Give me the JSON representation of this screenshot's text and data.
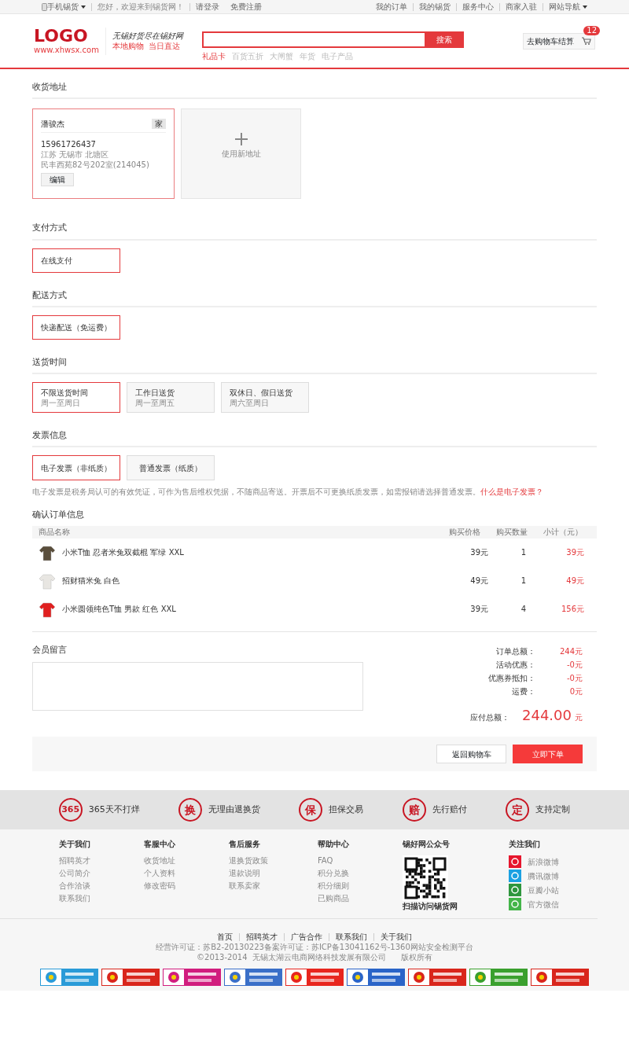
{
  "top_bar": {
    "left": [
      {
        "label": "手机锡货",
        "kind": "mobile"
      },
      {
        "label": "您好，欢迎来到锡货网！",
        "kind": "text"
      },
      {
        "label": "请登录",
        "kind": "link"
      },
      {
        "label": "免费注册",
        "kind": "link"
      }
    ],
    "right": [
      {
        "label": "我的订单",
        "dropdown": false
      },
      {
        "label": "我的锡货",
        "dropdown": false
      },
      {
        "label": "服务中心",
        "dropdown": false
      },
      {
        "label": "商家入驻",
        "dropdown": false
      },
      {
        "label": "网站导航",
        "dropdown": true
      }
    ]
  },
  "header": {
    "logo": "LOGO",
    "logo_url": "www.xhwsx.com",
    "slogan": "无锡好货尽在锡好网",
    "tagline": "本地购物  当日直达",
    "search_button": "搜索",
    "hot_words": [
      {
        "label": "礼品卡",
        "selected": true
      },
      {
        "label": "百货五折",
        "selected": false
      },
      {
        "label": "大闸蟹",
        "selected": false
      },
      {
        "label": "年货",
        "selected": false
      },
      {
        "label": "电子产品",
        "selected": false
      }
    ],
    "cart_button": "去购物车结算",
    "cart_count": "12"
  },
  "address": {
    "title": "收货地址",
    "cards": [
      {
        "kind": "address",
        "selected": true,
        "name": "潘骏杰",
        "tag": "家",
        "phone": "15961726437",
        "region": "江苏 无锡市 北塘区",
        "street": "民丰西苑82号202室(214045)",
        "edit": "编辑"
      },
      {
        "kind": "add",
        "selected": false,
        "label": "使用新地址"
      }
    ]
  },
  "option_groups": [
    {
      "title": "支付方式",
      "options": [
        {
          "label": "在线支付",
          "selected": true
        }
      ]
    },
    {
      "title": "配送方式",
      "options": [
        {
          "label": "快递配送（免运费）",
          "selected": true
        }
      ]
    },
    {
      "title": "送货时间",
      "options": [
        {
          "label": "不限送货时间",
          "sub": "周一至周日",
          "selected": true
        },
        {
          "label": "工作日送货",
          "sub": "周一至周五",
          "selected": false
        },
        {
          "label": "双休日、假日送货",
          "sub": "周六至周日",
          "selected": false
        }
      ]
    },
    {
      "title": "发票信息",
      "options": [
        {
          "label": "电子发票（非纸质）",
          "selected": true
        },
        {
          "label": "普通发票（纸质）",
          "selected": false
        }
      ],
      "note": "电子发票是税务局认可的有效凭证，可作为售后维权凭据，不随商品寄送。开票后不可更换纸质发票，如需报销请选择普通发票。",
      "note_link": "什么是电子发票？"
    }
  ],
  "order": {
    "title": "确认订单信息",
    "columns": [
      "商品名称",
      "购买价格",
      "购买数量",
      "小计（元）"
    ],
    "rows": [
      {
        "name": "小米T恤 忍者米兔双截棍 军绿 XXL",
        "price": "39元",
        "qty": "1",
        "subtotal": "39元",
        "color": "#5a4e3c"
      },
      {
        "name": "招财猫米兔 白色",
        "price": "49元",
        "qty": "1",
        "subtotal": "49元",
        "color": "#e8e6e2"
      },
      {
        "name": "小米圆领纯色T恤 男款 红色 XXL",
        "price": "39元",
        "qty": "4",
        "subtotal": "156元",
        "color": "#e02020"
      }
    ]
  },
  "message": {
    "title": "会员留言"
  },
  "summary": {
    "lines": [
      {
        "label": "订单总额：",
        "value": "244元"
      },
      {
        "label": "活动优惠：",
        "value": "-0元"
      },
      {
        "label": "优惠券抵扣：",
        "value": "-0元"
      },
      {
        "label": "运费：",
        "value": "0元"
      }
    ],
    "total_label": "应付总额：",
    "total": "244.00",
    "total_unit": "元"
  },
  "actions": {
    "back": "返回购物车",
    "submit": "立即下单"
  },
  "services": [
    {
      "icon": "365",
      "label": "365天不打烊"
    },
    {
      "icon": "换",
      "label": "无理由退换货"
    },
    {
      "icon": "保",
      "label": "担保交易"
    },
    {
      "icon": "赔",
      "label": "先行赔付"
    },
    {
      "icon": "定",
      "label": "支持定制"
    }
  ],
  "footer": {
    "columns": [
      {
        "title": "关于我们",
        "links": [
          "招聘英才",
          "公司简介",
          "合作洽谈",
          "联系我们"
        ]
      },
      {
        "title": "客服中心",
        "links": [
          "收货地址",
          "个人资料",
          "修改密码"
        ]
      },
      {
        "title": "售后服务",
        "links": [
          "退换货政策",
          "退款说明",
          "联系卖家"
        ]
      },
      {
        "title": "帮助中心",
        "links": [
          "FAQ",
          "积分兑换",
          "积分细则",
          "已购商品"
        ]
      }
    ],
    "qr": {
      "title": "锡好网公众号",
      "caption": "扫描访问锡货网"
    },
    "follow": {
      "title": "关注我们",
      "items": [
        {
          "label": "新浪微博",
          "color": "#e6162d"
        },
        {
          "label": "腾讯微博",
          "color": "#1ba1e2"
        },
        {
          "label": "豆瓣小站",
          "color": "#2e963d"
        },
        {
          "label": "官方微信",
          "color": "#44b549"
        }
      ]
    },
    "bottom_links": [
      "首页",
      "招聘英才",
      "广告合作",
      "联系我们",
      "关于我们"
    ],
    "license": "经营许可证：苏B2-20130223备案许可证：苏ICP备13041162号-1360网站安全检测平台",
    "copyright": "©2013-2014  无锡太湖云电商网络科技发展有限公司      版权所有",
    "badges": [
      {
        "color": "#2a9bd8"
      },
      {
        "color": "#d9261c"
      },
      {
        "color": "#d11d7e"
      },
      {
        "color": "#3a6fc8"
      },
      {
        "color": "#e8261e"
      },
      {
        "color": "#2a64c8"
      },
      {
        "color": "#d9261c"
      },
      {
        "color": "#3aa02e"
      },
      {
        "color": "#d9261c"
      }
    ]
  }
}
